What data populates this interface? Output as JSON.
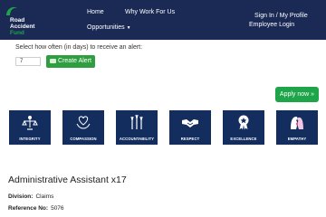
{
  "brand": {
    "line1": "Road",
    "line2": "Accident",
    "line3": "Fund",
    "accent_color": "#1ea54a",
    "navbar_color": "#1b2a55"
  },
  "nav": {
    "home": "Home",
    "why_work": "Why Work For Us",
    "opportunities": "Opportunities",
    "signin": "Sign In / My Profile",
    "employee_login": "Employee Login"
  },
  "alert": {
    "label": "Select how often (in days) to receive an alert:",
    "days_value": "7",
    "button": "Create Alert"
  },
  "apply_button": "Apply now »",
  "values": [
    {
      "label": "INTEGRITY",
      "icon": "scales-person-icon"
    },
    {
      "label": "COMPASSION",
      "icon": "heart-hands-icon"
    },
    {
      "label": "ACCOUNTABILITY",
      "icon": "raised-hands-icon"
    },
    {
      "label": "RESPECT",
      "icon": "handshake-icon"
    },
    {
      "label": "EXCELLENCE",
      "icon": "award-ribbon-icon"
    },
    {
      "label": "EMPATHY",
      "icon": "two-heads-icon"
    }
  ],
  "job": {
    "title": "Administrative Assistant x17",
    "division_label": "Division:",
    "division": "Claims",
    "ref_label": "Reference No:",
    "ref": "5076"
  }
}
